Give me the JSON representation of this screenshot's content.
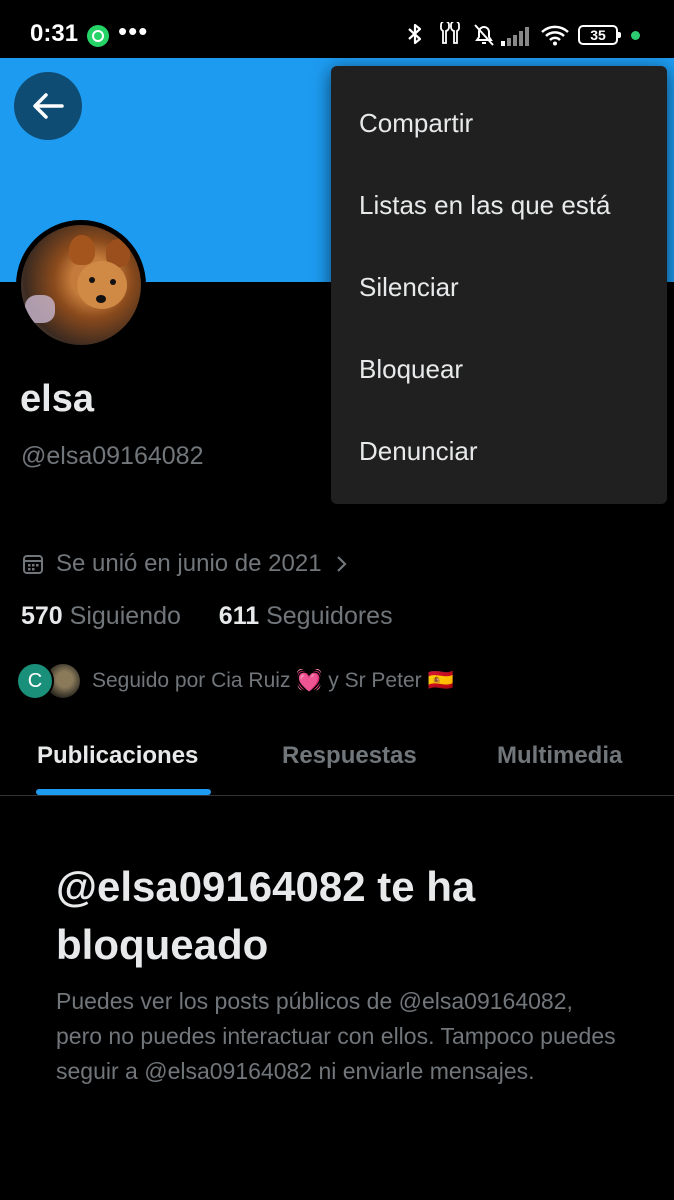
{
  "status_bar": {
    "time": "0:31",
    "more": "•••",
    "battery": "35"
  },
  "profile": {
    "name": "elsa",
    "handle": "@elsa09164082",
    "joined": "Se unió en junio de 2021",
    "following_count": "570",
    "following_label": "Siguiendo",
    "followers_count": "611",
    "followers_label": "Seguidores",
    "followed_by": "Seguido por Cia Ruiz 💓 y Sr Peter 🇪🇸",
    "follower_avatar_initial": "C"
  },
  "tabs": [
    {
      "label": "Publicaciones"
    },
    {
      "label": "Respuestas"
    },
    {
      "label": "Multimedia"
    }
  ],
  "blocked": {
    "title": "@elsa09164082 te ha bloqueado",
    "description": "Puedes ver los posts públicos de @elsa09164082, pero no puedes interactuar con ellos. Tampoco puedes seguir a @elsa09164082 ni enviarle mensajes."
  },
  "menu": {
    "items": [
      {
        "label": "Compartir"
      },
      {
        "label": "Listas en las que está"
      },
      {
        "label": "Silenciar"
      },
      {
        "label": "Bloquear"
      },
      {
        "label": "Denunciar"
      }
    ]
  },
  "colors": {
    "accent": "#1d9bf0",
    "background": "#000000",
    "muted_text": "#71767b",
    "menu_bg": "#202020"
  }
}
